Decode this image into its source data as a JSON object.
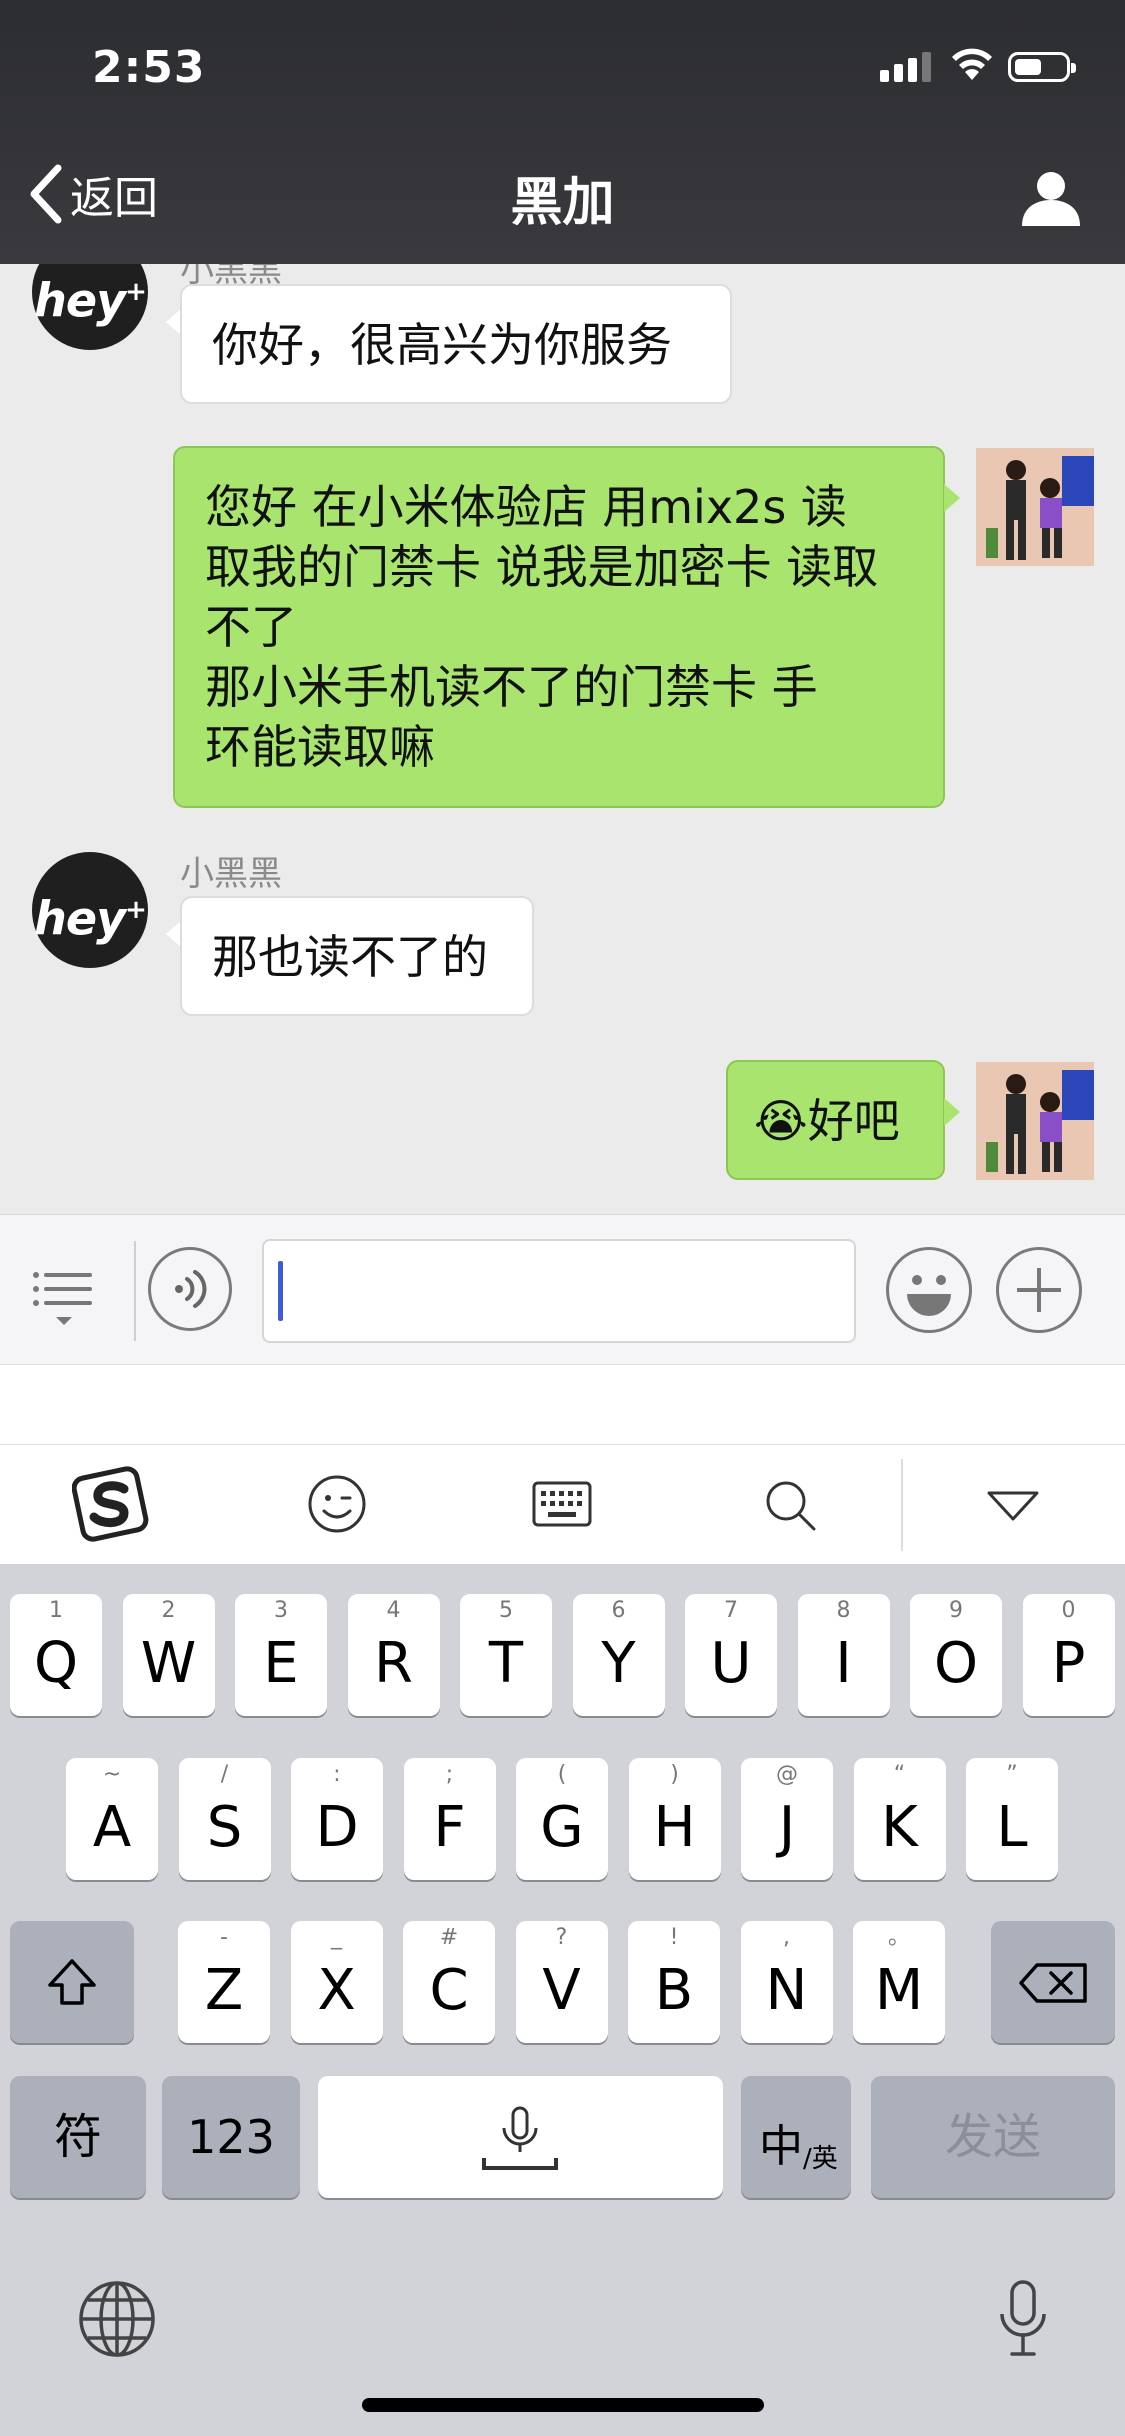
{
  "status_bar": {
    "time": "2:53"
  },
  "nav": {
    "back_label": "返回",
    "title": "黑加"
  },
  "messages": [
    {
      "side": "left",
      "sender": "小黑黑",
      "text": "你好，很高兴为你服务"
    },
    {
      "side": "right",
      "lines": [
        "您好 在小米体验店  用mix2s  读",
        "取我的门禁卡 说我是加密卡 读取",
        "不了",
        "那小米手机读不了的门禁卡   手",
        "环能读取嘛"
      ]
    },
    {
      "side": "left",
      "sender": "小黑黑",
      "text": "那也读不了的"
    },
    {
      "side": "right",
      "emoji": "😭",
      "text": "好吧"
    }
  ],
  "avatar_text": "hey",
  "avatar_sup": "+",
  "keyboard": {
    "row1": [
      {
        "hint": "1",
        "key": "Q"
      },
      {
        "hint": "2",
        "key": "W"
      },
      {
        "hint": "3",
        "key": "E"
      },
      {
        "hint": "4",
        "key": "R"
      },
      {
        "hint": "5",
        "key": "T"
      },
      {
        "hint": "6",
        "key": "Y"
      },
      {
        "hint": "7",
        "key": "U"
      },
      {
        "hint": "8",
        "key": "I"
      },
      {
        "hint": "9",
        "key": "O"
      },
      {
        "hint": "0",
        "key": "P"
      }
    ],
    "row2": [
      {
        "hint": "~",
        "key": "A"
      },
      {
        "hint": "/",
        "key": "S"
      },
      {
        "hint": ":",
        "key": "D"
      },
      {
        "hint": ";",
        "key": "F"
      },
      {
        "hint": "(",
        "key": "G"
      },
      {
        "hint": ")",
        "key": "H"
      },
      {
        "hint": "@",
        "key": "J"
      },
      {
        "hint": "“",
        "key": "K"
      },
      {
        "hint": "”",
        "key": "L"
      }
    ],
    "row3": [
      {
        "hint": "-",
        "key": "Z"
      },
      {
        "hint": "_",
        "key": "X"
      },
      {
        "hint": "#",
        "key": "C"
      },
      {
        "hint": "?",
        "key": "V"
      },
      {
        "hint": "!",
        "key": "B"
      },
      {
        "hint": ",",
        "key": "N"
      },
      {
        "hint": "。",
        "key": "M"
      }
    ],
    "symbols_label": "符",
    "numbers_label": "123",
    "lang_main": "中",
    "lang_sub": "/英",
    "send_label": "发送"
  }
}
